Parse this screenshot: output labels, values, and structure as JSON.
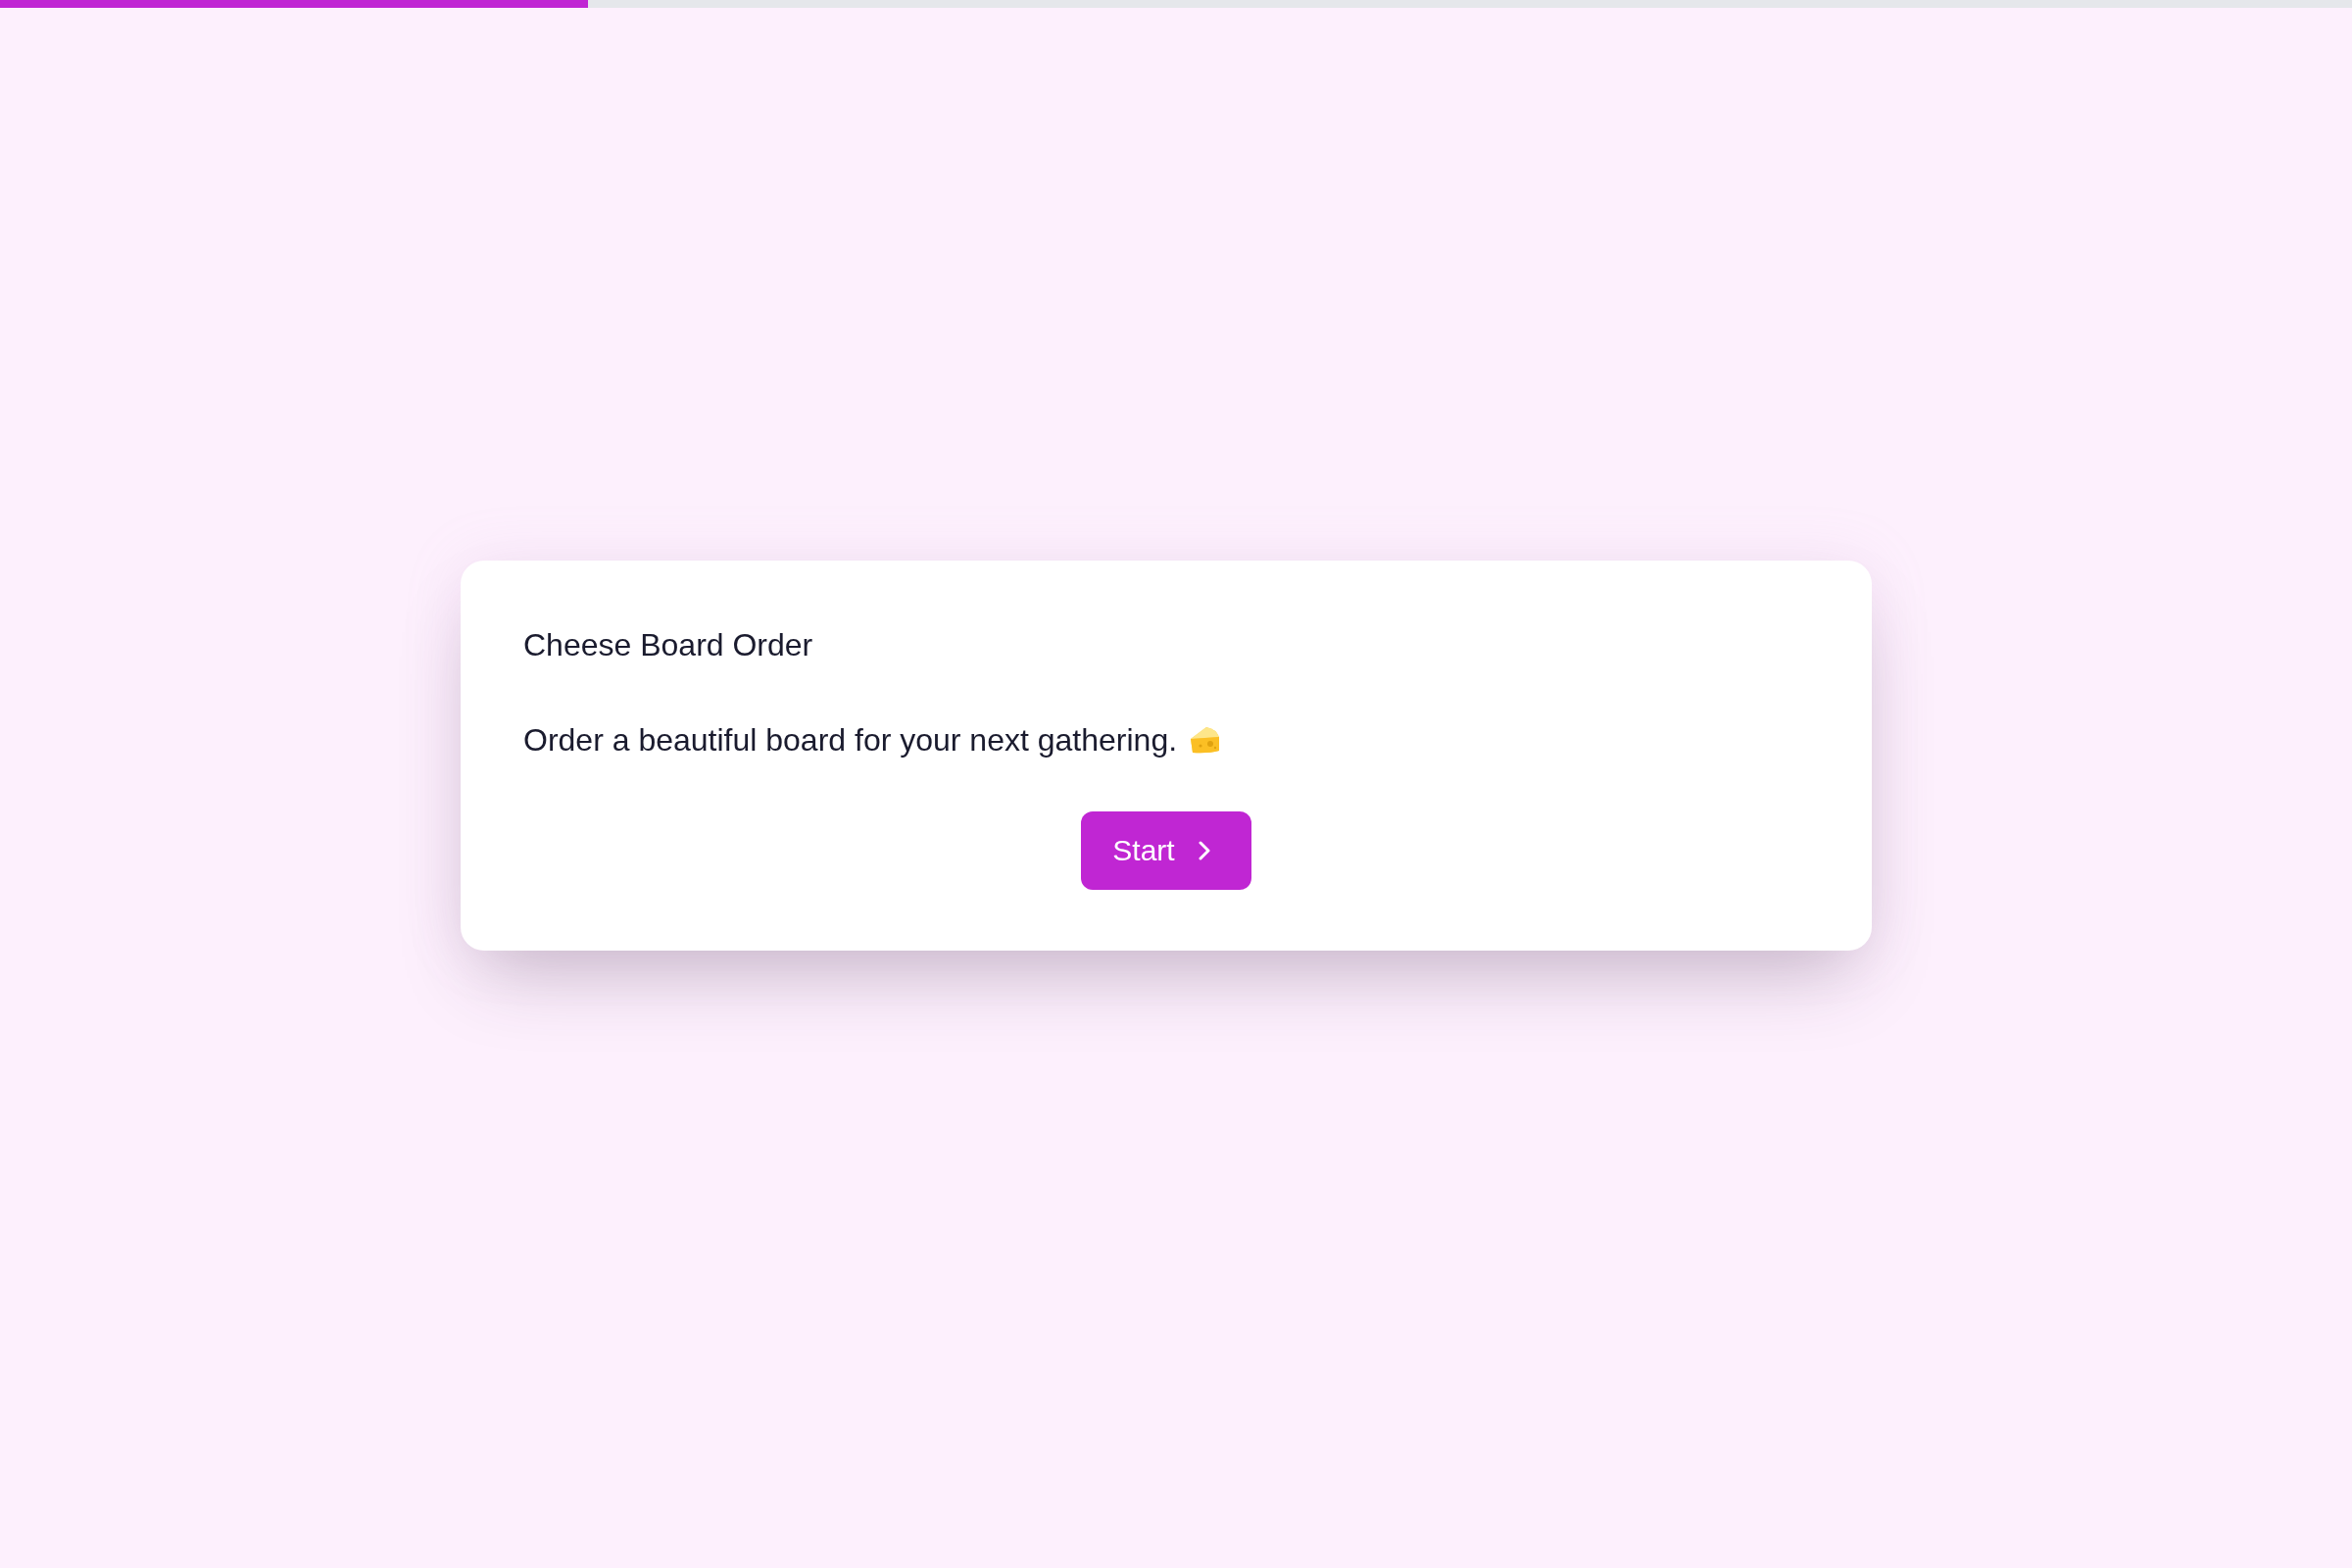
{
  "progress": {
    "level": 0.25
  },
  "card": {
    "title": "Cheese Board Order",
    "description": "Order a beautiful board for your next gathering.",
    "button": {
      "label": "Start"
    }
  }
}
